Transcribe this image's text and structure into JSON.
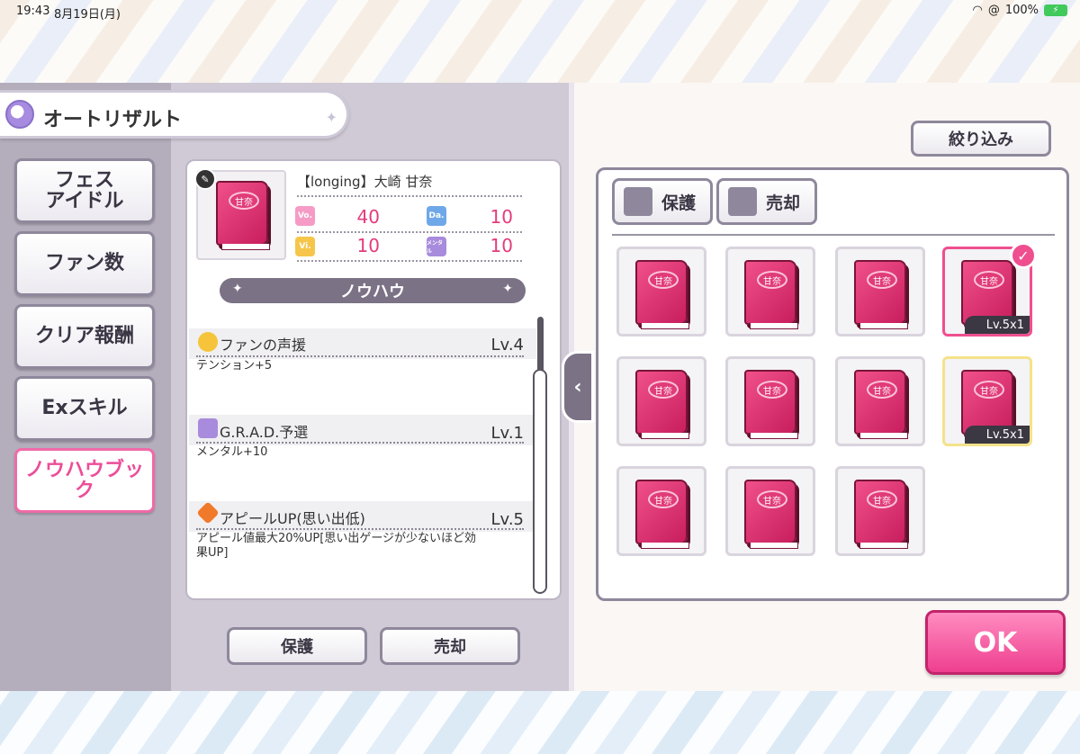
{
  "statusbar": {
    "time": "19:43",
    "date": "8月19日(月)",
    "battery": "100%"
  },
  "header": {
    "title": "オートリザルト"
  },
  "tabs": [
    {
      "label": "フェス\nアイドル"
    },
    {
      "label": "ファン数"
    },
    {
      "label": "クリア報酬"
    },
    {
      "label": "Exスキル"
    },
    {
      "label": "ノウハウブック"
    }
  ],
  "detail": {
    "name": "【longing】大崎 甘奈",
    "book_label": "甘奈",
    "stats": {
      "vo": {
        "badge": "Vo.",
        "value": "40",
        "color": "#f59bc6"
      },
      "da": {
        "badge": "Da.",
        "value": "10",
        "color": "#6fa8e8"
      },
      "vi": {
        "badge": "Vi.",
        "value": "10",
        "color": "#f6c64a"
      },
      "me": {
        "badge": "メンタル",
        "value": "10",
        "color": "#a88bdc"
      }
    },
    "section_title": "ノウハウ",
    "skills": [
      {
        "name": "ファンの声援",
        "level": "Lv.4",
        "desc": "テンション+5",
        "icon": "smile-icon"
      },
      {
        "name": "G.R.A.D.予選",
        "level": "Lv.1",
        "desc": "メンタル+10",
        "icon": "mental-icon"
      },
      {
        "name": "アピールUP(思い出低)",
        "level": "Lv.5",
        "desc": "アピール値最大20%UP[思い出ゲージが少ないほど効果UP]",
        "icon": "appeal-up-icon"
      }
    ]
  },
  "bottom_buttons": {
    "protect": "保護",
    "sell": "売却"
  },
  "right": {
    "filter": "絞り込み",
    "protect": "保護",
    "sell": "売却",
    "items": [
      {
        "label": "甘奈",
        "lv": "",
        "state": "normal"
      },
      {
        "label": "甘奈",
        "lv": "",
        "state": "normal"
      },
      {
        "label": "甘奈",
        "lv": "",
        "state": "normal"
      },
      {
        "label": "甘奈",
        "lv": "Lv.5x1",
        "state": "selected"
      },
      {
        "label": "甘奈",
        "lv": "",
        "state": "normal"
      },
      {
        "label": "甘奈",
        "lv": "",
        "state": "normal"
      },
      {
        "label": "甘奈",
        "lv": "",
        "state": "normal"
      },
      {
        "label": "甘奈",
        "lv": "Lv.5x1",
        "state": "highlight"
      },
      {
        "label": "甘奈",
        "lv": "",
        "state": "normal"
      },
      {
        "label": "甘奈",
        "lv": "",
        "state": "normal"
      },
      {
        "label": "甘奈",
        "lv": "",
        "state": "normal"
      }
    ],
    "ok": "OK"
  }
}
